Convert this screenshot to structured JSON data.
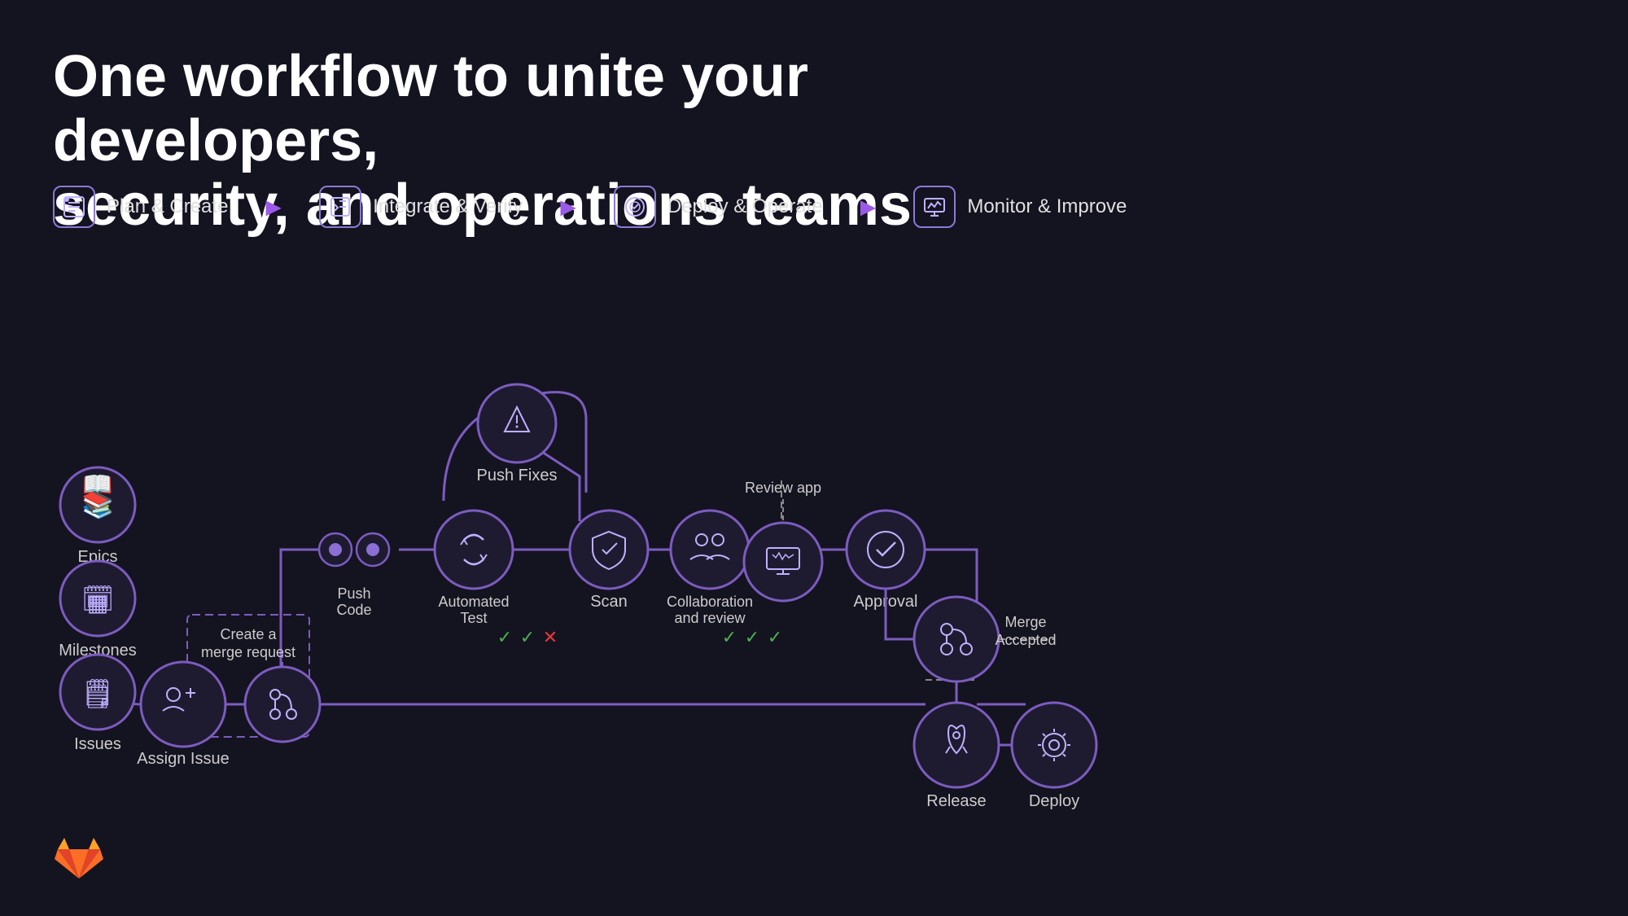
{
  "heading": {
    "line1": "One workflow to unite your developers,",
    "line2": "security, and operations teams"
  },
  "phases": [
    {
      "id": "plan",
      "label": "Plan & Create",
      "icon": "📋"
    },
    {
      "id": "integrate",
      "label": "Integrate & Verify",
      "icon": "✏️"
    },
    {
      "id": "deploy",
      "label": "Deploy & Operate",
      "icon": "⏱️"
    },
    {
      "id": "monitor",
      "label": "Monitor & Improve",
      "icon": "📈"
    }
  ],
  "nodes": {
    "epics": "Epics",
    "milestones": "Milestones",
    "issues": "Issues",
    "assign_issue": "Assign Issue",
    "create_merge": "Create a\nmerge request",
    "merge_request_node": "",
    "push_code": "Push\nCode",
    "automated_test": "Automated\nTest",
    "push_fixes": "Push Fixes",
    "scan": "Scan",
    "collab_review": "Collaboration\nand review",
    "review_app": "Review app",
    "review_app_node": "",
    "approval": "Approval",
    "merge_accepted": "Merge\nAccepted",
    "release": "Release",
    "deploy": "Deploy"
  }
}
